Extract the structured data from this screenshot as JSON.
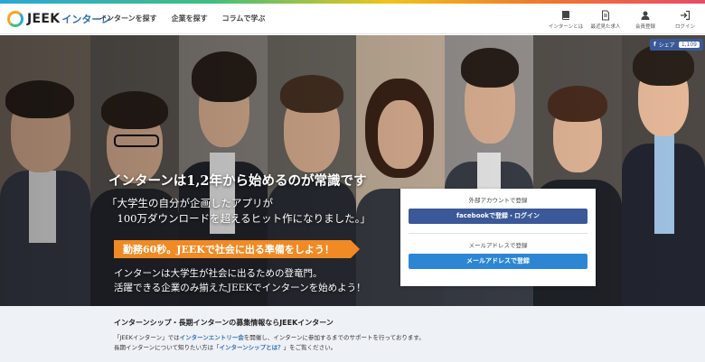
{
  "header": {
    "logo_text": "JEEK",
    "logo_sub": "インターン",
    "nav": [
      "インターンを探す",
      "企業を探す",
      "コラムで学ぶ"
    ],
    "right": [
      {
        "label": "インターンとは",
        "icon": "book-icon"
      },
      {
        "label": "最近見た求人",
        "icon": "document-icon"
      },
      {
        "label": "会員登録",
        "icon": "user-icon"
      },
      {
        "label": "ログイン",
        "icon": "login-icon"
      }
    ]
  },
  "hero": {
    "share_label": "シェア",
    "share_count": "1,109",
    "headline": "インターンは1,2年から始めるのが常識です",
    "quote_line1": "「大学生の自分が企画したアプリが",
    "quote_line2": "　100万ダウンロードを超えるヒット作になりました。」",
    "orange_band": "勤務60秒。JEEKで社会に出る準備をしよう！",
    "lead_line1": "インターンは大学生が社会に出るための登竜門。",
    "lead_line2": "活躍できる企業のみ揃えたJEEKでインターンを始めよう！"
  },
  "register": {
    "external_title": "外部アカウントで登録",
    "facebook_button": "facebookで登録・ログイン",
    "email_title": "メールアドレスで登録",
    "email_button": "メールアドレスで登録"
  },
  "info": {
    "title": "インターンシップ・長期インターンの募集情報ならJEEKインターン",
    "p1_a": "「JEEKインターン」では",
    "p1_link": "インターンエントリー会",
    "p1_b": "を開催し、インターンに参加するまでのサポートを行っております。",
    "p2_a": "長期インターンについて知りたい方は「",
    "p2_link": "インターンシップとは？",
    "p2_b": "」をご覧ください。"
  },
  "colors": {
    "facebook": "#3b5998",
    "email_button": "#2c86d4",
    "orange_band": "#f08a24",
    "link": "#2c6fb5"
  }
}
